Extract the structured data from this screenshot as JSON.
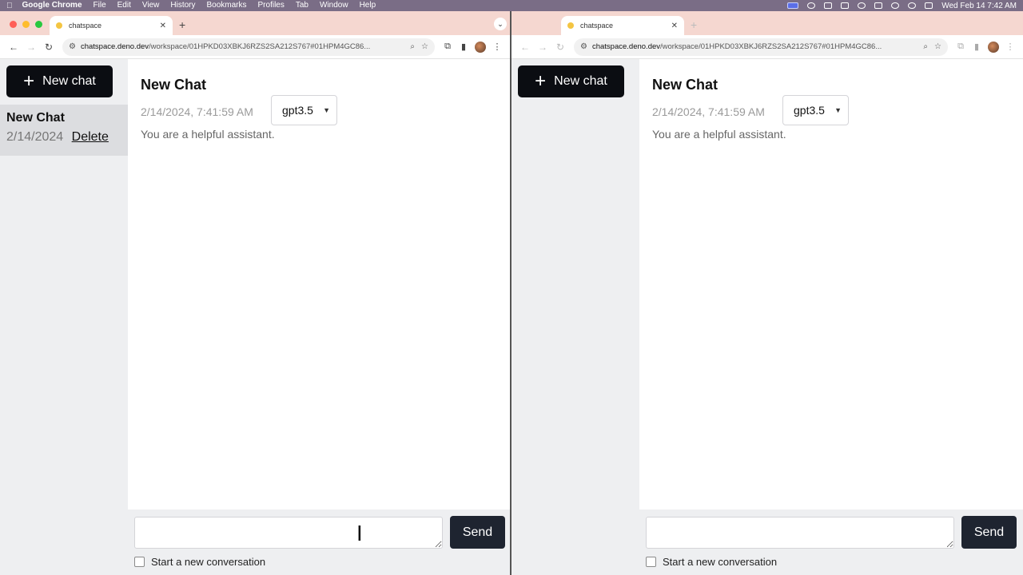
{
  "menubar": {
    "app_name": "Google Chrome",
    "items": [
      "File",
      "Edit",
      "View",
      "History",
      "Bookmarks",
      "Profiles",
      "Tab",
      "Window",
      "Help"
    ],
    "clock": "Wed Feb 14  7:42 AM"
  },
  "windows": [
    {
      "tab_title": "chatspace",
      "url_domain": "chatspace.deno.dev",
      "url_path": "/workspace/01HPKD03XBKJ6RZS2SA212S767#01HPM4GC86...",
      "sidebar": {
        "new_chat_label": "New chat",
        "chats": [
          {
            "title": "New Chat",
            "date": "2/14/2024",
            "delete_label": "Delete"
          }
        ]
      },
      "chat": {
        "title": "New Chat",
        "timestamp": "2/14/2024, 7:41:59 AM",
        "model": "gpt3.5",
        "system_prompt": "You are a helpful assistant."
      },
      "composer": {
        "input_value": "",
        "send_label": "Send",
        "new_conversation_label": "Start a new conversation"
      }
    },
    {
      "tab_title": "chatspace",
      "url_domain": "chatspace.deno.dev",
      "url_path": "/workspace/01HPKD03XBKJ6RZS2SA212S767#01HPM4GC86...",
      "sidebar": {
        "new_chat_label": "New chat",
        "chats": []
      },
      "chat": {
        "title": "New Chat",
        "timestamp": "2/14/2024, 7:41:59 AM",
        "model": "gpt3.5",
        "system_prompt": "You are a helpful assistant."
      },
      "composer": {
        "input_value": "",
        "send_label": "Send",
        "new_conversation_label": "Start a new conversation"
      }
    }
  ],
  "colors": {
    "menubar": "#7a6d86",
    "tabstrip": "#f5d7d0",
    "sidebar_bg": "#eeeff1",
    "primary_button": "#0b0d12",
    "send_button": "#1e2430"
  }
}
